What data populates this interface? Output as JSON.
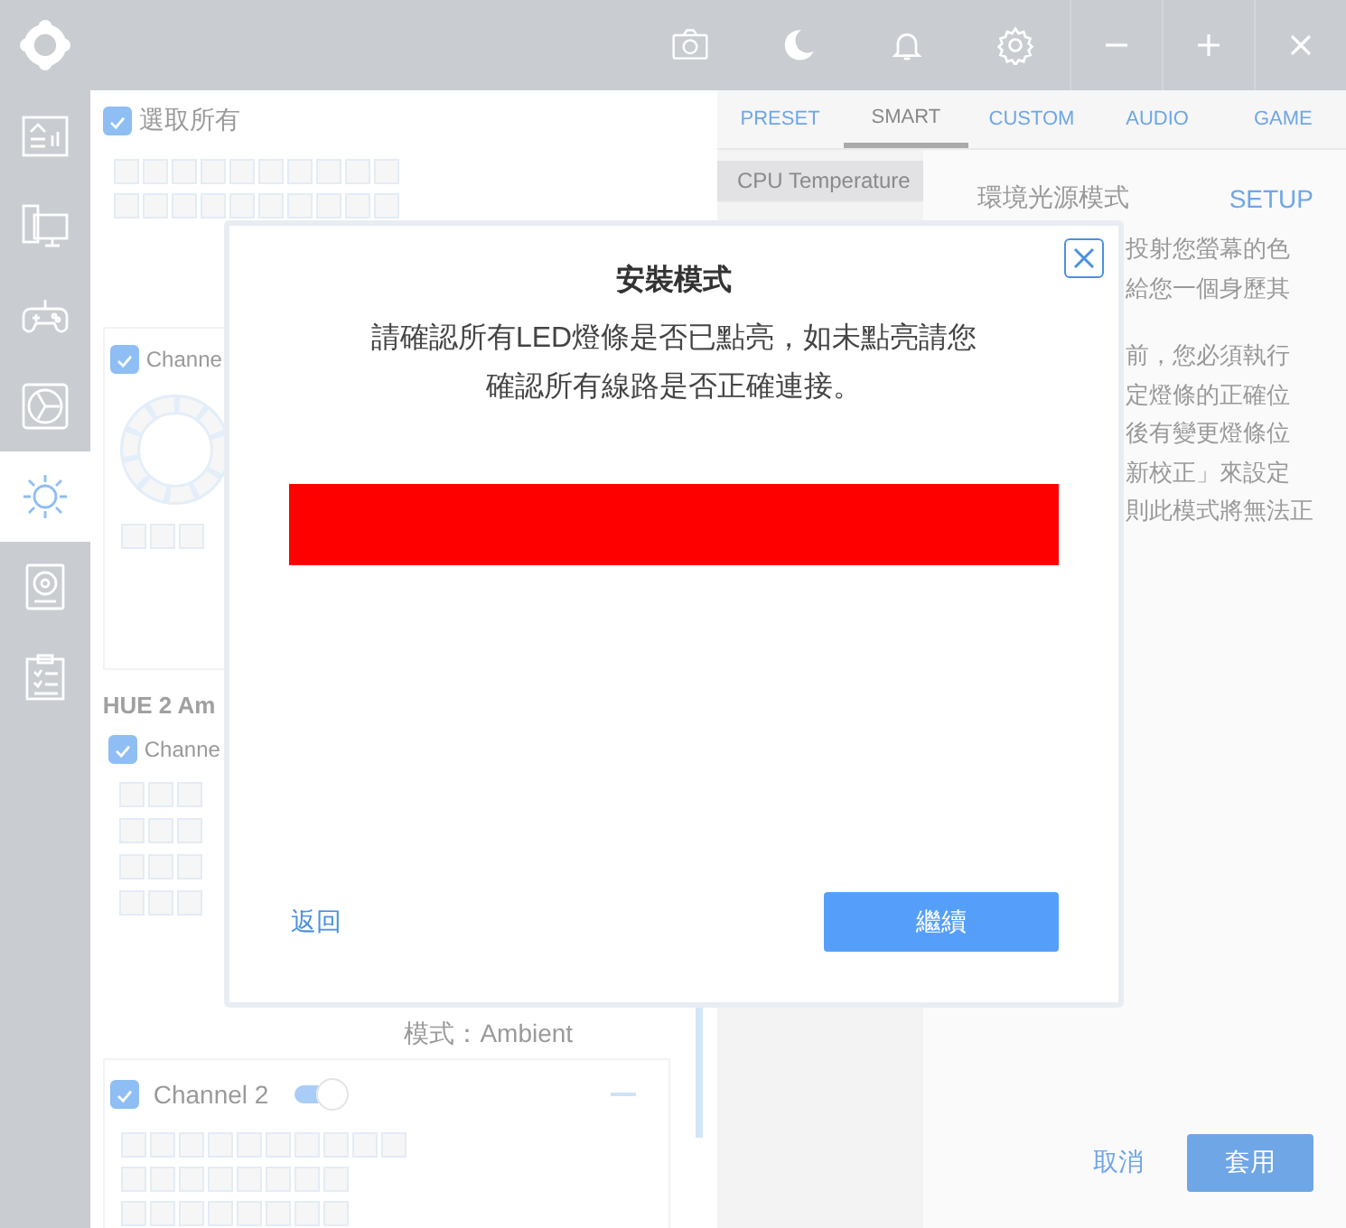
{
  "sidebar": {
    "items": [
      {
        "selected": false
      },
      {
        "selected": false
      },
      {
        "selected": false
      },
      {
        "selected": false
      },
      {
        "selected": true
      },
      {
        "selected": false
      },
      {
        "selected": false
      }
    ]
  },
  "left_panel": {
    "select_all": {
      "label": "選取所有",
      "checked": true
    },
    "channel_card": {
      "label": "Channe",
      "checked": true
    },
    "group": {
      "title": "HUE 2 Am",
      "channel": {
        "label": "Channe",
        "checked": true
      },
      "mode": "模式：Ambient"
    },
    "channel_2": {
      "label": "Channel 2",
      "checked": true,
      "on": true
    }
  },
  "right_panel": {
    "tabs": [
      {
        "label": "PRESET",
        "selected": false
      },
      {
        "label": "SMART",
        "selected": true
      },
      {
        "label": "CUSTOM",
        "selected": false
      },
      {
        "label": "AUDIO",
        "selected": false
      },
      {
        "label": "GAME",
        "selected": false
      }
    ],
    "sources": [
      {
        "label": "CPU Temperature",
        "selected": true
      }
    ],
    "title": "環境光源模式",
    "setup": "SETUP",
    "paragraphs": [
      [
        "投射您螢幕的色",
        "給您一個身歷其"
      ],
      [
        "前，您必須執行",
        "定燈條的正確位",
        "後有變更燈條位",
        "新校正」來設定",
        "則此模式將無法正"
      ]
    ],
    "cancel": "取消",
    "apply": "套用"
  },
  "modal": {
    "title": "安裝模式",
    "message": [
      "請確認所有LED燈條是否已點亮，如未點亮請您",
      "確認所有線路是否正確連接。"
    ],
    "back": "返回",
    "continue": "繼續"
  }
}
